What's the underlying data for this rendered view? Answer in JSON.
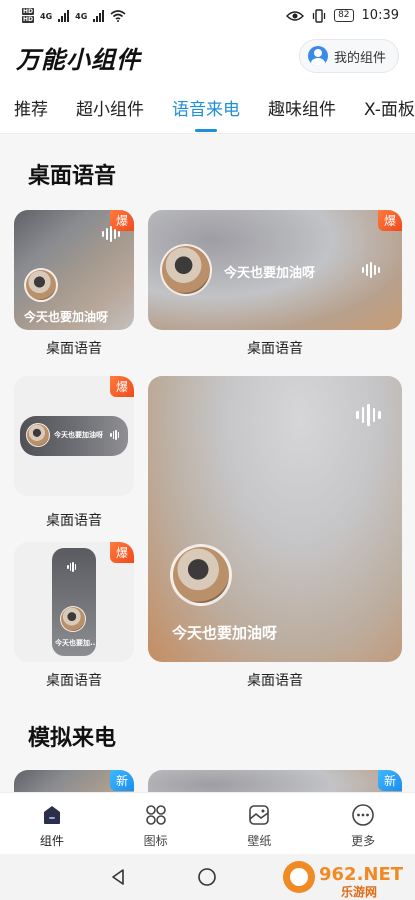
{
  "status_bar": {
    "hd": [
      "HD",
      "HD"
    ],
    "network": [
      "4G",
      "4G"
    ],
    "battery": "82",
    "time": "10:39"
  },
  "header": {
    "title": "万能小组件",
    "my_widgets": "我的组件"
  },
  "tabs": [
    {
      "label": "推荐",
      "active": false
    },
    {
      "label": "超小组件",
      "active": false
    },
    {
      "label": "语音来电",
      "active": true
    },
    {
      "label": "趣味组件",
      "active": false
    },
    {
      "label": "X-面板",
      "active": false
    }
  ],
  "sections": [
    {
      "title": "桌面语音",
      "cards": [
        {
          "label": "桌面语音",
          "badge": "爆",
          "caption": "今天也要加油呀"
        },
        {
          "label": "桌面语音",
          "badge": "爆",
          "caption": "今天也要加油呀"
        },
        {
          "label": "桌面语音",
          "badge": "爆",
          "caption": "今天也要加油呀"
        },
        {
          "label": "桌面语音",
          "badge": "爆",
          "caption": "今天也要加油呀"
        },
        {
          "label": "桌面语音",
          "badge": "爆",
          "caption": "今天也要加..."
        }
      ]
    },
    {
      "title": "模拟来电",
      "cards": [
        {
          "badge": "新"
        },
        {
          "badge": "新"
        }
      ]
    }
  ],
  "bottom_nav": [
    {
      "label": "组件",
      "icon": "widget-icon",
      "active": true
    },
    {
      "label": "图标",
      "icon": "icons-grid-icon",
      "active": false
    },
    {
      "label": "壁纸",
      "icon": "wallpaper-icon",
      "active": false
    },
    {
      "label": "更多",
      "icon": "more-icon",
      "active": false
    }
  ],
  "watermark": {
    "brand": "962.NET",
    "sub": "乐游网"
  },
  "colors": {
    "accent": "#1f8fd8",
    "hot_badge": "#f04a1e",
    "new_badge": "#1a8ef0"
  }
}
